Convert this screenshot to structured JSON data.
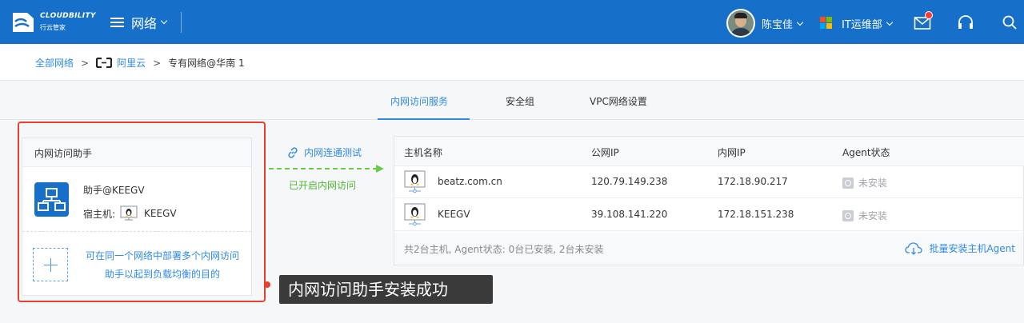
{
  "topbar": {
    "logo_en": "CLOUDBILITY",
    "logo_cn": "行云管家",
    "nav_label": "网络",
    "user_name": "陈宝佳",
    "department": "IT运维部",
    "icons": [
      "hamburger-icon",
      "mail-icon",
      "headset-icon",
      "search-icon"
    ],
    "brand_color": "#1670c9"
  },
  "breadcrumb": {
    "root": "全部网络",
    "separator": ">",
    "provider": "阿里云",
    "current": "专有网络@华南 1"
  },
  "tabs": [
    {
      "label": "内网访问服务",
      "active": true
    },
    {
      "label": "安全组",
      "active": false
    },
    {
      "label": "VPC网络设置",
      "active": false
    }
  ],
  "helper": {
    "title": "内网访问助手",
    "name": "助手@KEEGV",
    "host_label": "宿主机:",
    "host_name": "KEEGV",
    "add_hint_line1": "可在同一个网络中部署多个内网访问",
    "add_hint_line2": "助手以起到负载均衡的目的"
  },
  "connector": {
    "test_label": "内网连通测试",
    "status": "已开启内网访问",
    "status_color": "#52b536"
  },
  "table": {
    "headers": [
      "主机名称",
      "公网IP",
      "内网IP",
      "Agent状态"
    ],
    "rows": [
      {
        "host": "beatz.com.cn",
        "public_ip": "120.79.149.238",
        "private_ip": "172.18.90.217",
        "agent": "未安装"
      },
      {
        "host": "KEEGV",
        "public_ip": "39.108.141.220",
        "private_ip": "172.18.151.238",
        "agent": "未安装"
      }
    ],
    "summary": "共2台主机, Agent状态: 0台已安装, 2台未安装",
    "batch_label": "批量安装主机Agent"
  },
  "tooltip": {
    "text": "内网访问助手安装成功",
    "highlight_color": "#e8402d"
  }
}
